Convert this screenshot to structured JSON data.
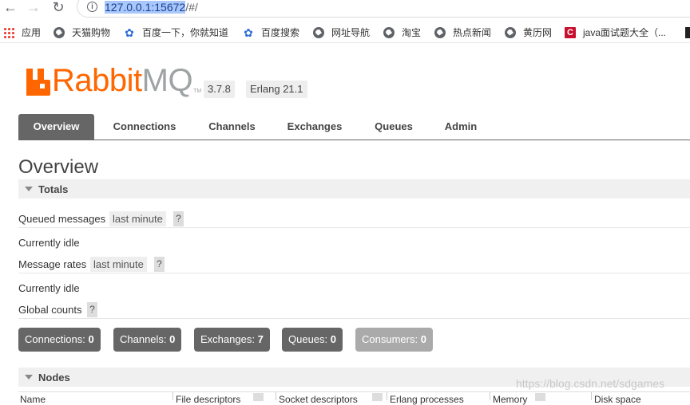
{
  "browser": {
    "back_icon": "arrow-left-icon",
    "forward_icon": "arrow-right-icon",
    "reload_icon": "reload-icon",
    "url_selected": "127.0.0.1:15672",
    "url_rest": "/#/"
  },
  "bookmarks": [
    {
      "label": "应用",
      "icon": "apps-grid-icon"
    },
    {
      "label": "天猫购物",
      "icon": "globe-icon"
    },
    {
      "label": "百度一下，你就知道",
      "icon": "paw-icon"
    },
    {
      "label": "百度搜索",
      "icon": "paw-icon"
    },
    {
      "label": "网址导航",
      "icon": "globe-icon"
    },
    {
      "label": "淘宝",
      "icon": "globe-icon"
    },
    {
      "label": "热点新闻",
      "icon": "globe-icon"
    },
    {
      "label": "黄历网",
      "icon": "globe-icon"
    },
    {
      "label": "java面试题大全（...",
      "icon": "csdn-icon"
    }
  ],
  "brand": {
    "rabbit": "Rabbit",
    "mq": "MQ",
    "tm": "TM"
  },
  "versions": {
    "rabbitmq": "3.7.8",
    "erlang": "Erlang 21.1"
  },
  "tabs": [
    "Overview",
    "Connections",
    "Channels",
    "Exchanges",
    "Queues",
    "Admin"
  ],
  "page_title": "Overview",
  "totals": {
    "header": "Totals",
    "queued_messages": "Queued messages",
    "queued_range": "last minute",
    "help": "?",
    "idle_1": "Currently idle",
    "message_rates": "Message rates",
    "rates_range": "last minute",
    "idle_2": "Currently idle",
    "global_counts": "Global counts"
  },
  "counts": [
    {
      "label": "Connections:",
      "value": "0"
    },
    {
      "label": "Channels:",
      "value": "0"
    },
    {
      "label": "Exchanges:",
      "value": "7"
    },
    {
      "label": "Queues:",
      "value": "0"
    },
    {
      "label": "Consumers:",
      "value": "0"
    }
  ],
  "nodes": {
    "header": "Nodes",
    "columns": [
      "Name",
      "File descriptors",
      "Socket descriptors",
      "Erlang processes",
      "Memory",
      "Disk space"
    ]
  },
  "watermark": "https://blog.csdn.net/sdgames"
}
